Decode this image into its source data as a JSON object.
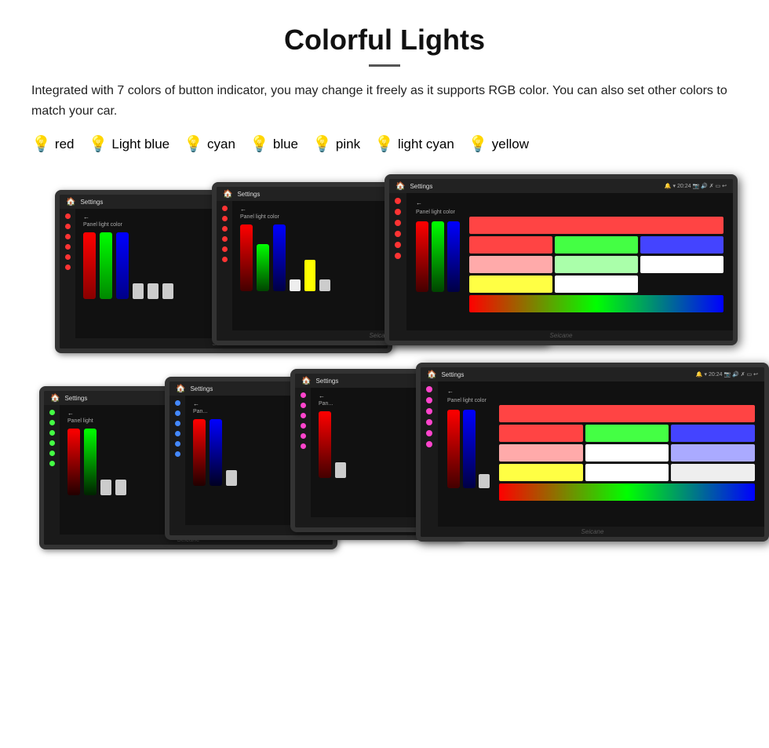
{
  "header": {
    "title": "Colorful Lights",
    "description": "Integrated with 7 colors of button indicator, you may change it freely as it supports RGB color. You can also set other colors to match your car."
  },
  "colors": [
    {
      "name": "red",
      "color": "#ff2222",
      "bulb": "🔴"
    },
    {
      "name": "Light blue",
      "color": "#66aaff",
      "bulb": "💙"
    },
    {
      "name": "cyan",
      "color": "#00cccc",
      "bulb": "🔵"
    },
    {
      "name": "blue",
      "color": "#0044ff",
      "bulb": "💙"
    },
    {
      "name": "pink",
      "color": "#ff66cc",
      "bulb": "💗"
    },
    {
      "name": "light cyan",
      "color": "#88eeff",
      "bulb": "💠"
    },
    {
      "name": "yellow",
      "color": "#ffdd00",
      "bulb": "💛"
    }
  ],
  "brand": "Seicane",
  "settings_label": "Settings",
  "back_label": "←",
  "panel_light_label": "Panel light color"
}
